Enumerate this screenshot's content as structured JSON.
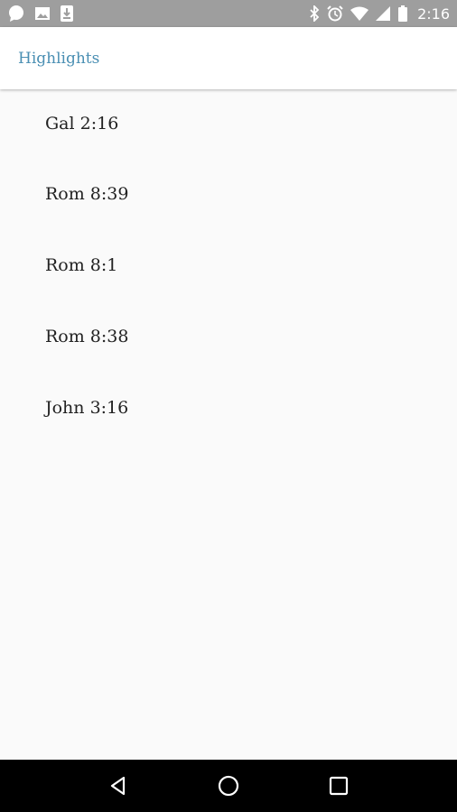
{
  "status_bar": {
    "time": "2:16",
    "icons_left": [
      "chat-bubble-icon",
      "image-icon",
      "download-icon"
    ],
    "icons_right": [
      "bluetooth-icon",
      "alarm-icon",
      "wifi-icon",
      "cell-signal-icon",
      "battery-icon"
    ],
    "background": "#9e9e9e"
  },
  "app_bar": {
    "title": "Highlights",
    "title_color": "#4a8fb3"
  },
  "highlights": [
    {
      "reference": "Gal 2:16"
    },
    {
      "reference": "Rom 8:39"
    },
    {
      "reference": "Rom 8:1"
    },
    {
      "reference": "Rom 8:38"
    },
    {
      "reference": "John 3:16"
    }
  ],
  "nav_bar": {
    "buttons": [
      "back-icon",
      "home-icon",
      "recents-icon"
    ]
  }
}
